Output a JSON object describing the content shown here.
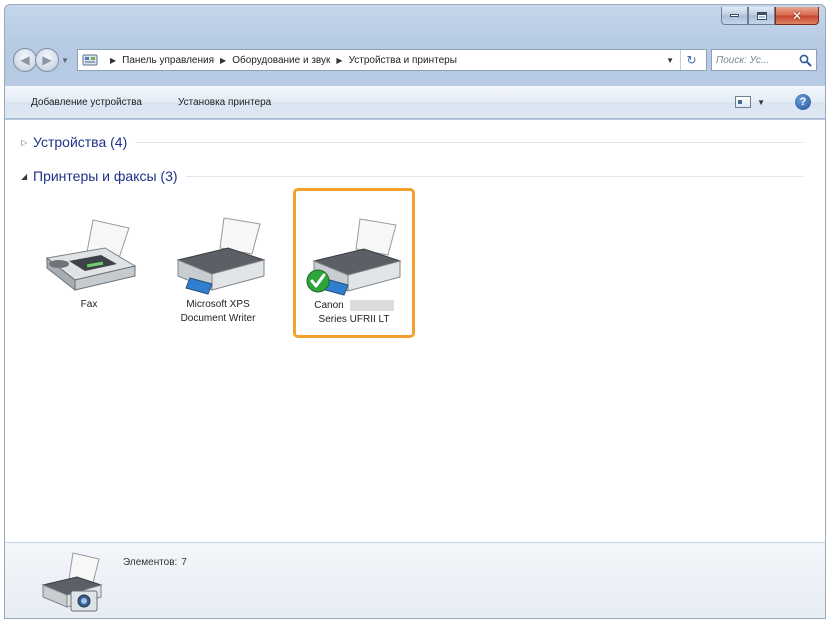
{
  "address_bar": {
    "crumbs": [
      "Панель управления",
      "Оборудование и звук",
      "Устройства и принтеры"
    ]
  },
  "search": {
    "placeholder": "Поиск: Ус..."
  },
  "toolbar": {
    "add_device": "Добавление устройства",
    "add_printer": "Установка принтера"
  },
  "groups": {
    "devices": {
      "label": "Устройства (4)",
      "expanded": false
    },
    "printers": {
      "label": "Принтеры и факсы (3)",
      "expanded": true
    }
  },
  "printers": [
    {
      "line1": "Fax",
      "line2": "",
      "default": false,
      "selected": false
    },
    {
      "line1": "Microsoft XPS",
      "line2": "Document Writer",
      "default": false,
      "selected": false
    },
    {
      "line1": "Canon",
      "line2": "Series UFRII LT",
      "default": true,
      "selected": true
    }
  ],
  "details": {
    "label": "Элементов:",
    "count": "7"
  },
  "colors": {
    "selection_border": "#f4a02c",
    "group_label": "#1e3287",
    "default_check": "#2fa43a"
  },
  "icons": {
    "nav_back": "back-arrow-icon",
    "nav_forward": "forward-arrow-icon",
    "address": "control-panel-icon",
    "refresh": "refresh-icon",
    "search": "magnifier-icon",
    "view": "view-options-icon",
    "help": "help-icon"
  }
}
